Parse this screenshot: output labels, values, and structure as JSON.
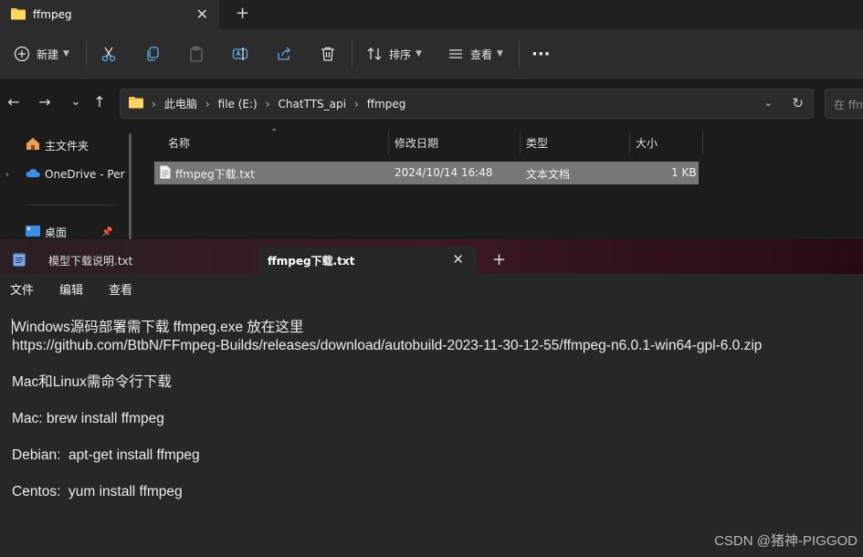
{
  "explorer": {
    "tab_title": "ffmpeg",
    "toolbar": {
      "new_label": "新建",
      "sort_label": "排序",
      "view_label": "查看",
      "more_label": "···"
    },
    "breadcrumbs": [
      "此电脑",
      "file (E:)",
      "ChatTTS_api",
      "ffmpeg"
    ],
    "search_placeholder": "在 ffm",
    "nav": {
      "home": "主文件夹",
      "onedrive": "OneDrive - Per",
      "desktop": "桌面"
    },
    "columns": {
      "name": "名称",
      "modified": "修改日期",
      "type": "类型",
      "size": "大小"
    },
    "files": [
      {
        "name": "ffmpeg下载.txt",
        "modified": "2024/10/14 16:48",
        "type": "文本文档",
        "size": "1 KB"
      }
    ]
  },
  "notepad": {
    "tabs": [
      {
        "label": "模型下载说明.txt"
      },
      {
        "label": "ffmpeg下载.txt"
      }
    ],
    "menu": [
      "文件",
      "编辑",
      "查看"
    ],
    "lines": [
      "Windows源码部署需下载 ffmpeg.exe 放在这里",
      "https://github.com/BtbN/FFmpeg-Builds/releases/download/autobuild-2023-11-30-12-55/ffmpeg-n6.0.1-win64-gpl-6.0.zip",
      "",
      "Mac和Linux需命令行下载",
      "",
      "Mac: brew install ffmpeg",
      "",
      "Debian:  apt-get install ffmpeg",
      "",
      "Centos:  yum install ffmpeg"
    ]
  },
  "watermark": "CSDN @猪神-PIGGOD",
  "colors": {
    "folder": "#f4c14a",
    "onedrive": "#3a8ee6",
    "selected_row": "#777777",
    "notepad_icon": "#7aa7e8"
  }
}
